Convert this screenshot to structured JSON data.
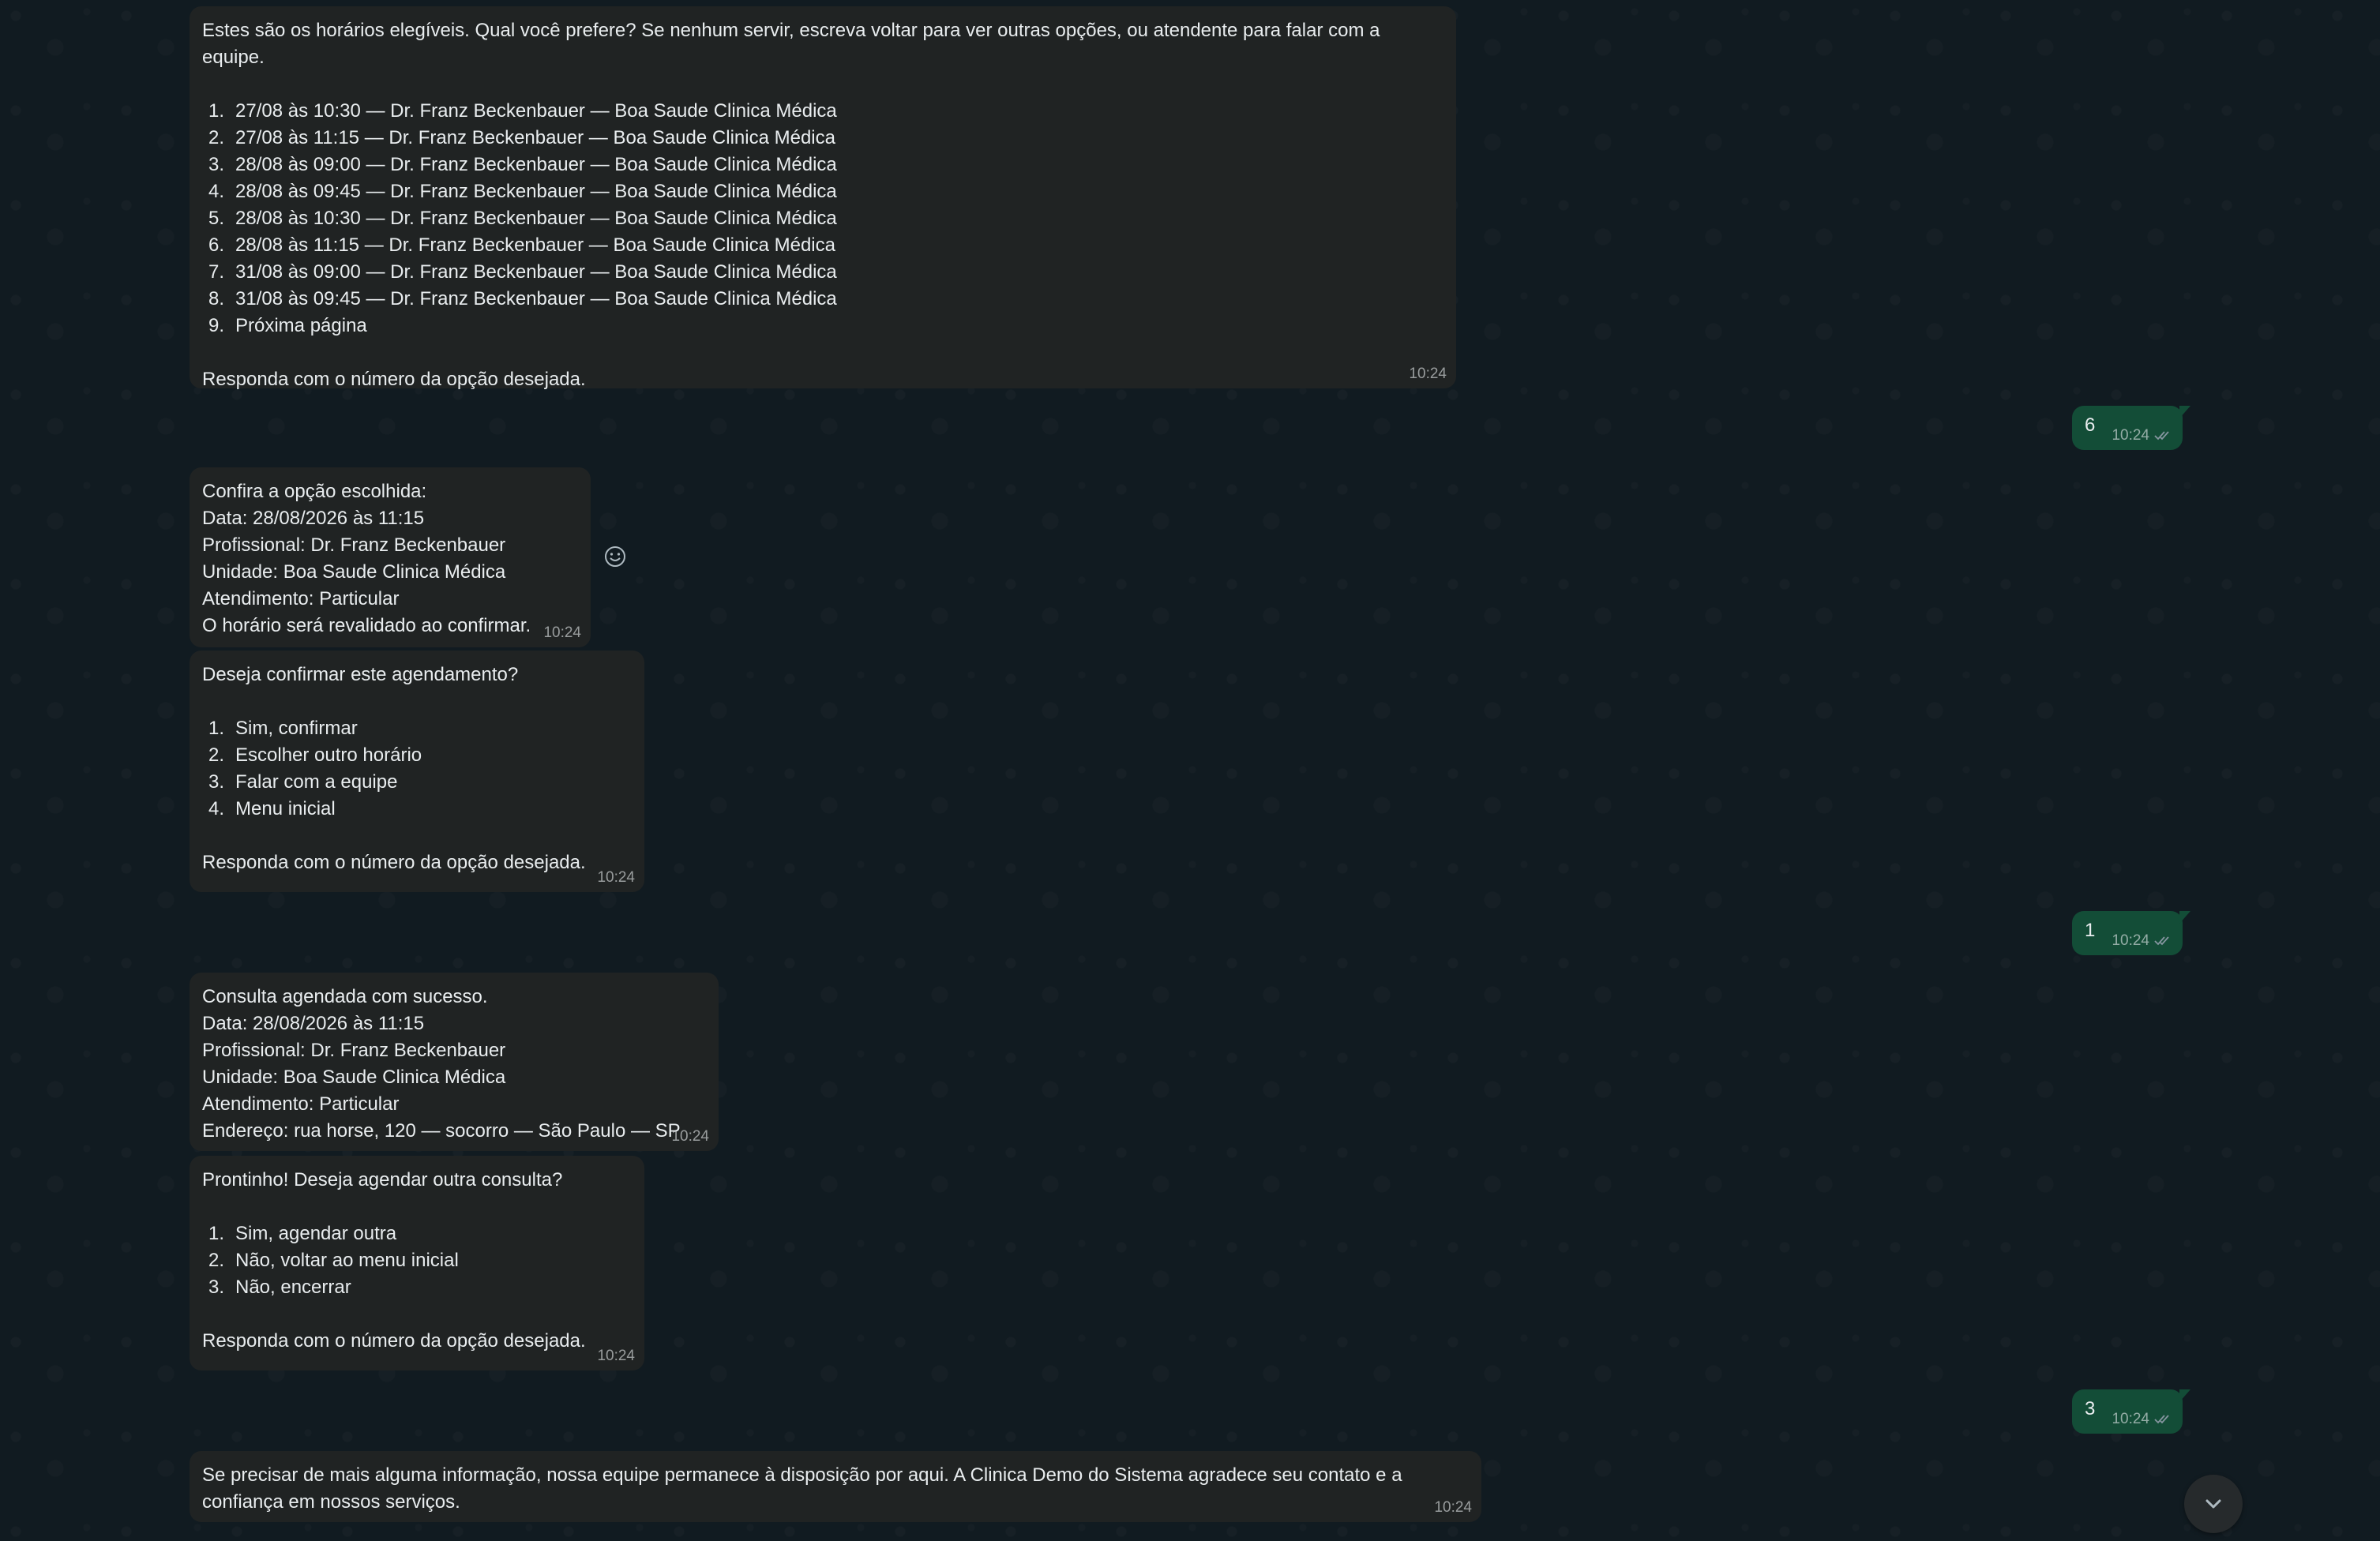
{
  "messages": {
    "m1": {
      "intro": "Estes são os horários elegíveis. Qual você prefere? Se nenhum servir, escreva voltar para ver outras opções, ou atendente para falar com a equipe.",
      "options": [
        {
          "n": "1.",
          "text": "27/08 às 10:30 — Dr. Franz Beckenbauer — Boa Saude Clinica Médica"
        },
        {
          "n": "2.",
          "text": "27/08 às 11:15 — Dr. Franz Beckenbauer — Boa Saude Clinica Médica"
        },
        {
          "n": "3.",
          "text": "28/08 às 09:00 — Dr. Franz Beckenbauer — Boa Saude Clinica Médica"
        },
        {
          "n": "4.",
          "text": "28/08 às 09:45 — Dr. Franz Beckenbauer — Boa Saude Clinica Médica"
        },
        {
          "n": "5.",
          "text": "28/08 às 10:30 — Dr. Franz Beckenbauer — Boa Saude Clinica Médica"
        },
        {
          "n": "6.",
          "text": "28/08 às 11:15 — Dr. Franz Beckenbauer — Boa Saude Clinica Médica"
        },
        {
          "n": "7.",
          "text": "31/08 às 09:00 — Dr. Franz Beckenbauer — Boa Saude Clinica Médica"
        },
        {
          "n": "8.",
          "text": "31/08 às 09:45 — Dr. Franz Beckenbauer — Boa Saude Clinica Médica"
        },
        {
          "n": "9.",
          "text": "Próxima página"
        }
      ],
      "outro": "Responda com o número da opção desejada.",
      "time": "10:24"
    },
    "r1": {
      "text": "6",
      "time": "10:24"
    },
    "m2": {
      "lines": [
        "Confira a opção escolhida:",
        "Data: 28/08/2026 às 11:15",
        "Profissional: Dr. Franz Beckenbauer",
        "Unidade: Boa Saude Clinica Médica",
        "Atendimento: Particular",
        "O horário será revalidado ao confirmar."
      ],
      "time": "10:24"
    },
    "m3": {
      "intro": "Deseja confirmar este agendamento?",
      "options": [
        {
          "n": "1.",
          "text": "Sim, confirmar"
        },
        {
          "n": "2.",
          "text": "Escolher outro horário"
        },
        {
          "n": "3.",
          "text": "Falar com a equipe"
        },
        {
          "n": "4.",
          "text": "Menu inicial"
        }
      ],
      "outro": "Responda com o número da opção desejada.",
      "time": "10:24"
    },
    "r2": {
      "text": "1",
      "time": "10:24"
    },
    "m4": {
      "lines": [
        "Consulta agendada com sucesso.",
        "Data: 28/08/2026 às 11:15",
        "Profissional: Dr. Franz Beckenbauer",
        "Unidade: Boa Saude Clinica Médica",
        "Atendimento: Particular",
        "Endereço: rua horse, 120 — socorro — São Paulo — SP"
      ],
      "time": "10:24"
    },
    "m5": {
      "intro": "Prontinho! Deseja agendar outra consulta?",
      "options": [
        {
          "n": "1.",
          "text": "Sim, agendar outra"
        },
        {
          "n": "2.",
          "text": "Não, voltar ao menu inicial"
        },
        {
          "n": "3.",
          "text": "Não, encerrar"
        }
      ],
      "outro": "Responda com o número da opção desejada.",
      "time": "10:24"
    },
    "r3": {
      "text": "3",
      "time": "10:24"
    },
    "m6": {
      "lines": [
        "Se precisar de mais alguma informação, nossa equipe permanece à disposição por aqui. A Clinica Demo do Sistema agradece seu contato e a",
        "confiança em nossos serviços."
      ],
      "time": "10:24"
    }
  },
  "icons": {
    "read_receipt": "double-check-icon",
    "emoji": "smiley-icon",
    "scroll_down": "chevron-down-icon"
  },
  "colors": {
    "background": "#111b21",
    "incoming_bubble": "#202323",
    "outgoing_bubble": "#134d37",
    "text": "#e9edef",
    "tick_read": "#53bdeb"
  }
}
